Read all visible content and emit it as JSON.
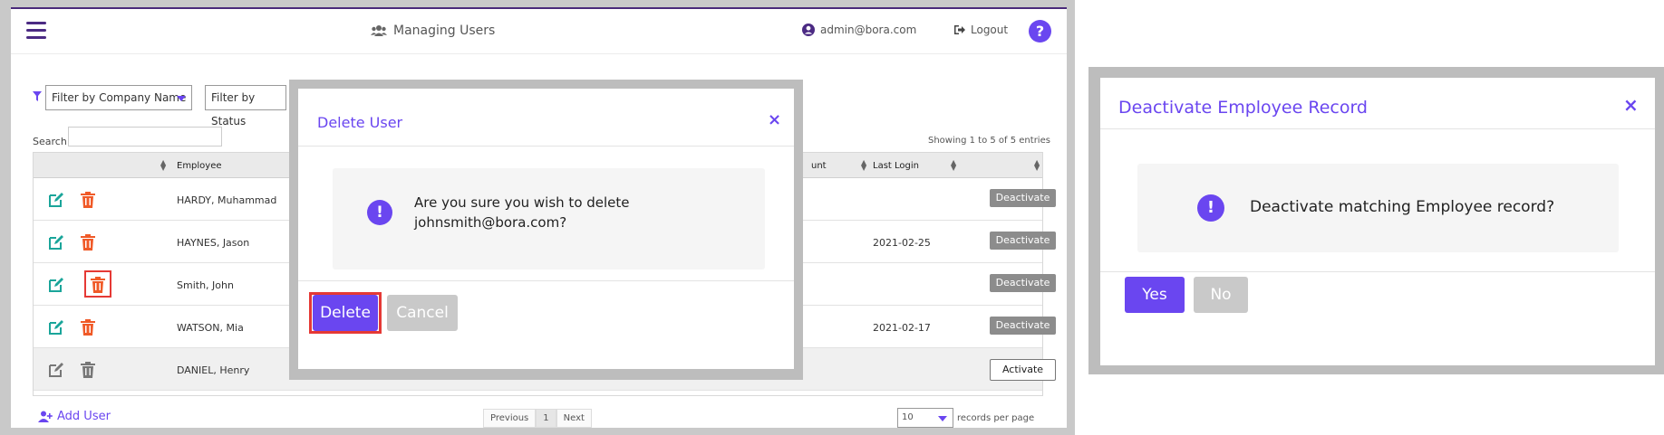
{
  "header": {
    "title": "Managing Users",
    "user_email": "admin@bora.com",
    "logout_label": "Logout",
    "help_label": "?"
  },
  "filters": {
    "company": "Filter by Company Name",
    "status": "Filter by Status"
  },
  "search": {
    "label": "Search:",
    "value": ""
  },
  "table": {
    "showing": "Showing 1 to 5 of 5 entries",
    "columns": {
      "employee": "Employee",
      "account": "unt",
      "last_login": "Last Login"
    },
    "rows": [
      {
        "employee": "HARDY, Muhammad",
        "last_login": "",
        "action": "Deactivate",
        "active": true
      },
      {
        "employee": "HAYNES, Jason",
        "last_login": "2021-02-25",
        "action": "Deactivate",
        "active": true
      },
      {
        "employee": "Smith, John",
        "last_login": "",
        "action": "Deactivate",
        "active": true
      },
      {
        "employee": "WATSON, Mia",
        "last_login": "2021-02-17",
        "action": "Deactivate",
        "active": true
      },
      {
        "employee": "DANIEL, Henry",
        "last_login": "",
        "action": "Activate",
        "active": false
      }
    ]
  },
  "footer": {
    "add_user": "Add User",
    "previous": "Previous",
    "page": "1",
    "next": "Next",
    "per_page_value": "10",
    "per_page_label": "records per page"
  },
  "delete_modal": {
    "title": "Delete User",
    "close": "×",
    "message": "Are you sure you wish to delete johnsmith@bora.com?",
    "delete_label": "Delete",
    "cancel_label": "Cancel"
  },
  "deactivate_modal": {
    "title": "Deactivate Employee Record",
    "close": "×",
    "message": "Deactivate matching Employee record?",
    "yes_label": "Yes",
    "no_label": "No"
  },
  "colors": {
    "accent": "#6a46f0",
    "edit_icon": "#1aa59a",
    "delete_icon": "#f05a28",
    "highlight": "#e53935"
  }
}
